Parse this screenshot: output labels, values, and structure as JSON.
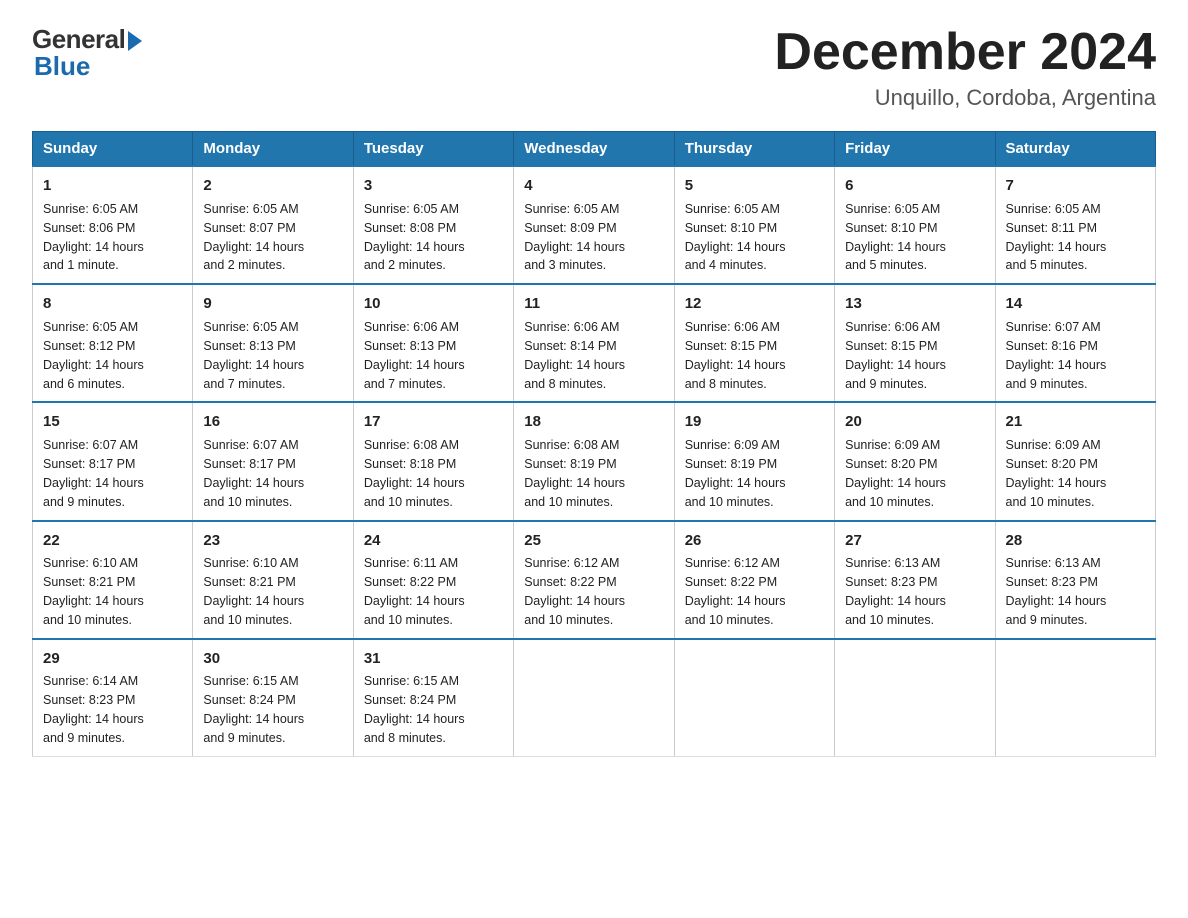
{
  "logo": {
    "general": "General",
    "blue": "Blue"
  },
  "title": "December 2024",
  "subtitle": "Unquillo, Cordoba, Argentina",
  "days_of_week": [
    "Sunday",
    "Monday",
    "Tuesday",
    "Wednesday",
    "Thursday",
    "Friday",
    "Saturday"
  ],
  "weeks": [
    [
      {
        "day": "1",
        "sunrise": "6:05 AM",
        "sunset": "8:06 PM",
        "daylight": "14 hours and 1 minute."
      },
      {
        "day": "2",
        "sunrise": "6:05 AM",
        "sunset": "8:07 PM",
        "daylight": "14 hours and 2 minutes."
      },
      {
        "day": "3",
        "sunrise": "6:05 AM",
        "sunset": "8:08 PM",
        "daylight": "14 hours and 2 minutes."
      },
      {
        "day": "4",
        "sunrise": "6:05 AM",
        "sunset": "8:09 PM",
        "daylight": "14 hours and 3 minutes."
      },
      {
        "day": "5",
        "sunrise": "6:05 AM",
        "sunset": "8:10 PM",
        "daylight": "14 hours and 4 minutes."
      },
      {
        "day": "6",
        "sunrise": "6:05 AM",
        "sunset": "8:10 PM",
        "daylight": "14 hours and 5 minutes."
      },
      {
        "day": "7",
        "sunrise": "6:05 AM",
        "sunset": "8:11 PM",
        "daylight": "14 hours and 5 minutes."
      }
    ],
    [
      {
        "day": "8",
        "sunrise": "6:05 AM",
        "sunset": "8:12 PM",
        "daylight": "14 hours and 6 minutes."
      },
      {
        "day": "9",
        "sunrise": "6:05 AM",
        "sunset": "8:13 PM",
        "daylight": "14 hours and 7 minutes."
      },
      {
        "day": "10",
        "sunrise": "6:06 AM",
        "sunset": "8:13 PM",
        "daylight": "14 hours and 7 minutes."
      },
      {
        "day": "11",
        "sunrise": "6:06 AM",
        "sunset": "8:14 PM",
        "daylight": "14 hours and 8 minutes."
      },
      {
        "day": "12",
        "sunrise": "6:06 AM",
        "sunset": "8:15 PM",
        "daylight": "14 hours and 8 minutes."
      },
      {
        "day": "13",
        "sunrise": "6:06 AM",
        "sunset": "8:15 PM",
        "daylight": "14 hours and 9 minutes."
      },
      {
        "day": "14",
        "sunrise": "6:07 AM",
        "sunset": "8:16 PM",
        "daylight": "14 hours and 9 minutes."
      }
    ],
    [
      {
        "day": "15",
        "sunrise": "6:07 AM",
        "sunset": "8:17 PM",
        "daylight": "14 hours and 9 minutes."
      },
      {
        "day": "16",
        "sunrise": "6:07 AM",
        "sunset": "8:17 PM",
        "daylight": "14 hours and 10 minutes."
      },
      {
        "day": "17",
        "sunrise": "6:08 AM",
        "sunset": "8:18 PM",
        "daylight": "14 hours and 10 minutes."
      },
      {
        "day": "18",
        "sunrise": "6:08 AM",
        "sunset": "8:19 PM",
        "daylight": "14 hours and 10 minutes."
      },
      {
        "day": "19",
        "sunrise": "6:09 AM",
        "sunset": "8:19 PM",
        "daylight": "14 hours and 10 minutes."
      },
      {
        "day": "20",
        "sunrise": "6:09 AM",
        "sunset": "8:20 PM",
        "daylight": "14 hours and 10 minutes."
      },
      {
        "day": "21",
        "sunrise": "6:09 AM",
        "sunset": "8:20 PM",
        "daylight": "14 hours and 10 minutes."
      }
    ],
    [
      {
        "day": "22",
        "sunrise": "6:10 AM",
        "sunset": "8:21 PM",
        "daylight": "14 hours and 10 minutes."
      },
      {
        "day": "23",
        "sunrise": "6:10 AM",
        "sunset": "8:21 PM",
        "daylight": "14 hours and 10 minutes."
      },
      {
        "day": "24",
        "sunrise": "6:11 AM",
        "sunset": "8:22 PM",
        "daylight": "14 hours and 10 minutes."
      },
      {
        "day": "25",
        "sunrise": "6:12 AM",
        "sunset": "8:22 PM",
        "daylight": "14 hours and 10 minutes."
      },
      {
        "day": "26",
        "sunrise": "6:12 AM",
        "sunset": "8:22 PM",
        "daylight": "14 hours and 10 minutes."
      },
      {
        "day": "27",
        "sunrise": "6:13 AM",
        "sunset": "8:23 PM",
        "daylight": "14 hours and 10 minutes."
      },
      {
        "day": "28",
        "sunrise": "6:13 AM",
        "sunset": "8:23 PM",
        "daylight": "14 hours and 9 minutes."
      }
    ],
    [
      {
        "day": "29",
        "sunrise": "6:14 AM",
        "sunset": "8:23 PM",
        "daylight": "14 hours and 9 minutes."
      },
      {
        "day": "30",
        "sunrise": "6:15 AM",
        "sunset": "8:24 PM",
        "daylight": "14 hours and 9 minutes."
      },
      {
        "day": "31",
        "sunrise": "6:15 AM",
        "sunset": "8:24 PM",
        "daylight": "14 hours and 8 minutes."
      },
      null,
      null,
      null,
      null
    ]
  ],
  "labels": {
    "sunrise": "Sunrise:",
    "sunset": "Sunset:",
    "daylight": "Daylight:"
  }
}
